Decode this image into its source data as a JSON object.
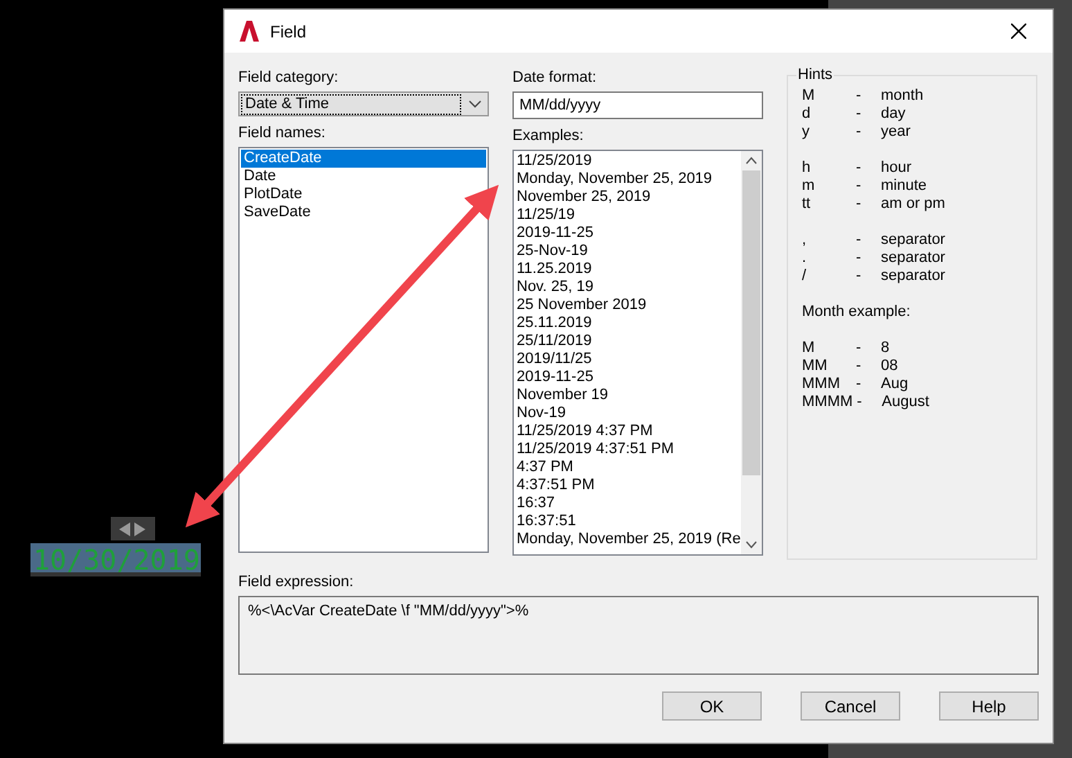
{
  "canvas": {
    "field_value": "10/30/2019"
  },
  "window": {
    "title": "Field"
  },
  "field_category": {
    "label": "Field category:",
    "value": "Date & Time"
  },
  "field_names": {
    "label": "Field names:",
    "items": [
      {
        "text": "CreateDate",
        "selected": true
      },
      {
        "text": "Date",
        "selected": false
      },
      {
        "text": "PlotDate",
        "selected": false
      },
      {
        "text": "SaveDate",
        "selected": false
      }
    ]
  },
  "date_format": {
    "label": "Date format:",
    "value": "MM/dd/yyyy"
  },
  "examples": {
    "label": "Examples:",
    "items": [
      "11/25/2019",
      "Monday, November 25, 2019",
      "November 25, 2019",
      "11/25/19",
      "2019-11-25",
      "25-Nov-19",
      "11.25.2019",
      "Nov. 25, 19",
      "25 November 2019",
      "25.11.2019",
      "25/11/2019",
      "2019/11/25",
      "2019-11-25",
      "November 19",
      "Nov-19",
      "11/25/2019 4:37 PM",
      "11/25/2019 4:37:51 PM",
      "4:37 PM",
      "4:37:51 PM",
      "16:37",
      "16:37:51",
      "Monday, November 25, 2019 (Re"
    ]
  },
  "hints": {
    "title": "Hints",
    "groups": [
      [
        {
          "key": "M",
          "meaning": "month"
        },
        {
          "key": "d",
          "meaning": "day"
        },
        {
          "key": "y",
          "meaning": "year"
        }
      ],
      [
        {
          "key": "h",
          "meaning": "hour"
        },
        {
          "key": "m",
          "meaning": "minute"
        },
        {
          "key": "tt",
          "meaning": "am or pm"
        }
      ],
      [
        {
          "key": ",",
          "meaning": "separator"
        },
        {
          "key": ".",
          "meaning": "separator"
        },
        {
          "key": "/",
          "meaning": "separator"
        }
      ]
    ],
    "month_example": {
      "label": "Month example:",
      "items": [
        {
          "key": "M",
          "meaning": "8"
        },
        {
          "key": "MM",
          "meaning": "08"
        },
        {
          "key": "MMM",
          "meaning": "Aug"
        },
        {
          "key": "MMMM",
          "meaning": "August"
        }
      ]
    },
    "separator": "-"
  },
  "field_expression": {
    "label": "Field expression:",
    "value": "%<\\AcVar CreateDate \\f \"MM/dd/yyyy\">%"
  },
  "buttons": [
    "OK",
    "Cancel",
    "Help"
  ]
}
